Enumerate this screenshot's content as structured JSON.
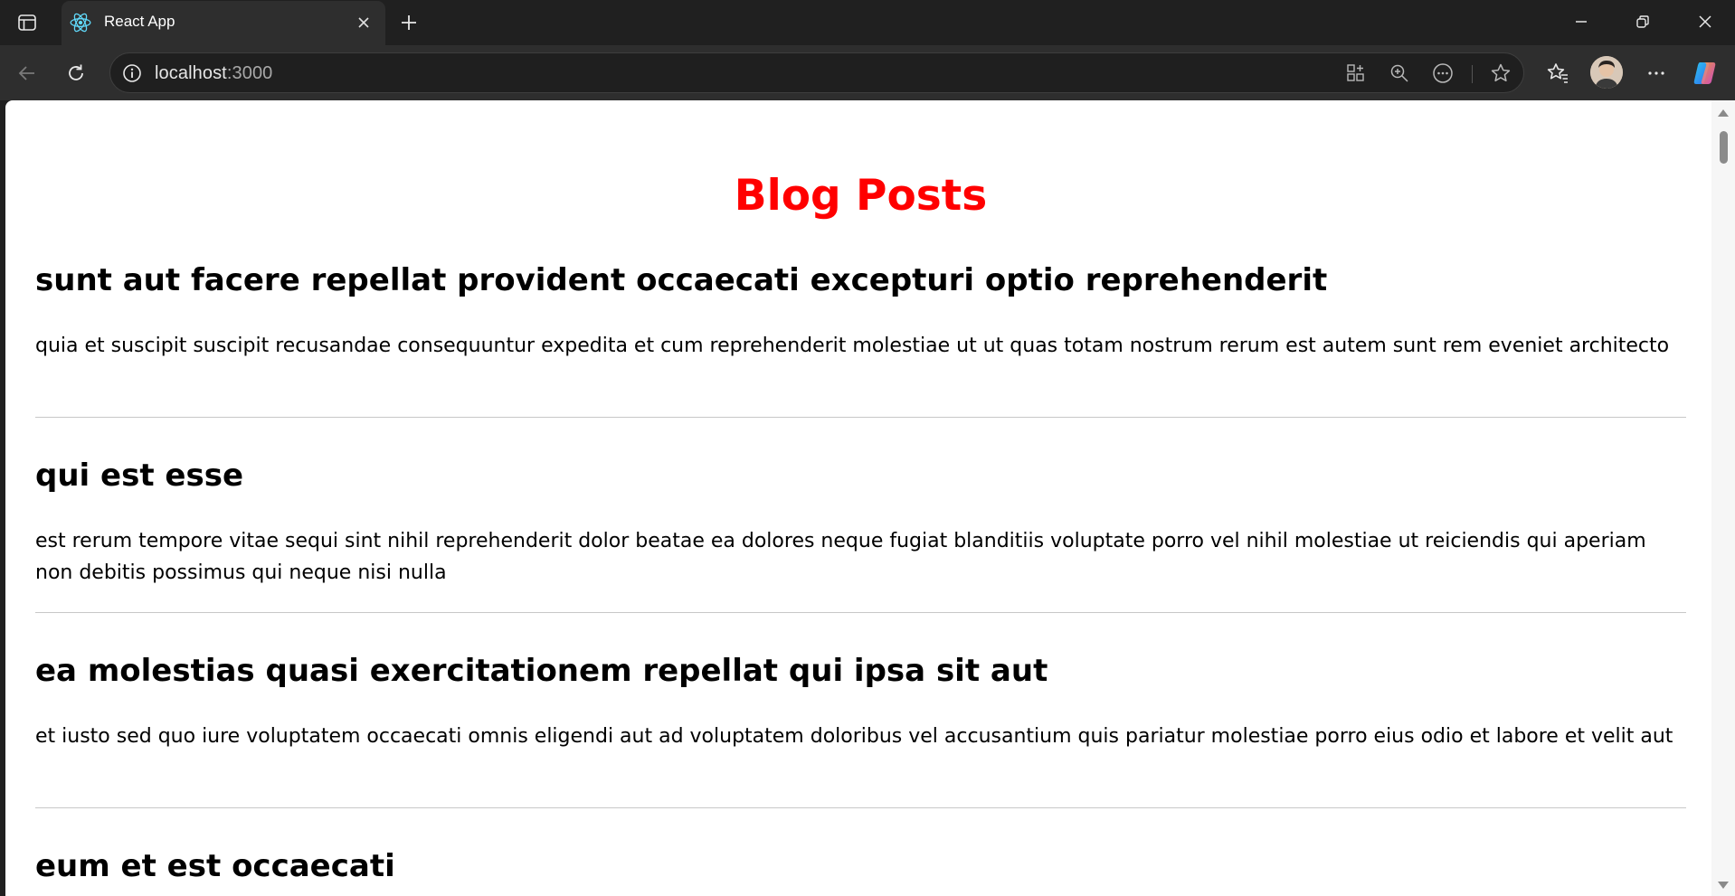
{
  "browser": {
    "tab": {
      "title": "React App",
      "favicon": "react-logo-icon"
    },
    "address": {
      "host": "localhost",
      "port": ":3000"
    },
    "icons": {
      "tab_actions": "tab-actions-icon",
      "new_tab": "plus-icon",
      "back": "back-arrow-icon",
      "refresh": "refresh-icon",
      "site_info": "info-icon",
      "app_available": "app-available-icon",
      "zoom": "zoom-icon",
      "more_tools": "more-tools-icon",
      "favorite": "star-icon",
      "favorites": "favorites-icon",
      "profile": "avatar",
      "settings": "more-icon",
      "copilot": "copilot-icon"
    },
    "colors": {
      "chrome_bg": "#202020",
      "toolbar_bg": "#2e2e2e",
      "omnibox_bg": "#1f1f1f"
    }
  },
  "page": {
    "title": "Blog Posts",
    "title_color": "#ff0000",
    "posts": [
      {
        "title": "sunt aut facere repellat provident occaecati excepturi optio reprehenderit",
        "body": "quia et suscipit suscipit recusandae consequuntur expedita et cum reprehenderit molestiae ut ut quas totam nostrum rerum est autem sunt rem eveniet architecto"
      },
      {
        "title": "qui est esse",
        "body": "est rerum tempore vitae sequi sint nihil reprehenderit dolor beatae ea dolores neque fugiat blanditiis voluptate porro vel nihil molestiae ut reiciendis qui aperiam non debitis possimus qui neque nisi nulla"
      },
      {
        "title": "ea molestias quasi exercitationem repellat qui ipsa sit aut",
        "body": "et iusto sed quo iure voluptatem occaecati omnis eligendi aut ad voluptatem doloribus vel accusantium quis pariatur molestiae porro eius odio et labore et velit aut"
      },
      {
        "title": "eum et est occaecati",
        "body": ""
      }
    ]
  }
}
